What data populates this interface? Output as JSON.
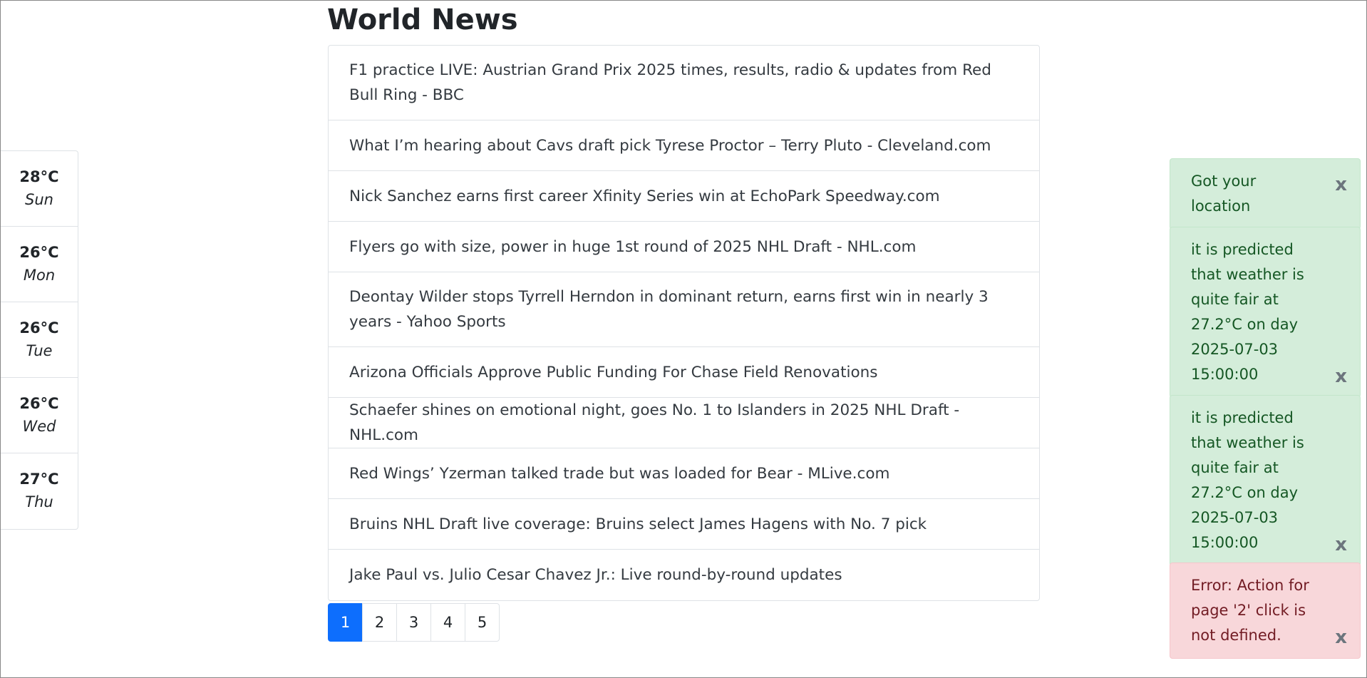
{
  "page_title": "World News",
  "weather": [
    {
      "temp": "28°C",
      "day": "Sun"
    },
    {
      "temp": "26°C",
      "day": "Mon"
    },
    {
      "temp": "26°C",
      "day": "Tue"
    },
    {
      "temp": "26°C",
      "day": "Wed"
    },
    {
      "temp": "27°C",
      "day": "Thu"
    }
  ],
  "news": [
    "F1 practice LIVE: Austrian Grand Prix 2025 times, results, radio & updates from Red Bull Ring - BBC",
    "What I’m hearing about Cavs draft pick Tyrese Proctor – Terry Pluto - Cleveland.com",
    "Nick Sanchez earns first career Xfinity Series win at EchoPark Speedway.com",
    "Flyers go with size, power in huge 1st round of 2025 NHL Draft - NHL.com",
    "Deontay Wilder stops Tyrrell Herndon in dominant return, earns first win in nearly 3 years - Yahoo Sports",
    "Arizona Officials Approve Public Funding For Chase Field Renovations",
    "Schaefer shines on emotional night, goes No. 1 to Islanders in 2025 NHL Draft - NHL.com",
    "Red Wings’ Yzerman talked trade but was loaded for Bear - MLive.com",
    "Bruins NHL Draft live coverage: Bruins select James Hagens with No. 7 pick",
    "Jake Paul vs. Julio Cesar Chavez Jr.: Live round-by-round updates"
  ],
  "pagination": {
    "pages": [
      "1",
      "2",
      "3",
      "4",
      "5"
    ],
    "active": "1"
  },
  "toasts": [
    {
      "type": "success",
      "text": "Got your location",
      "close": "x"
    },
    {
      "type": "success",
      "text": "it is predicted that weather is quite fair at 27.2°C on day 2025-07-03 15:00:00",
      "close": "x"
    },
    {
      "type": "success",
      "text": "it is predicted that weather is quite fair at 27.2°C on day 2025-07-03 15:00:00",
      "close": "x"
    },
    {
      "type": "error",
      "text": "Error: Action for page '2' click is not defined.",
      "close": "x"
    }
  ],
  "colors": {
    "active_page": "#0d6efd",
    "success_bg": "#d4edda",
    "error_bg": "#f8d7da"
  }
}
